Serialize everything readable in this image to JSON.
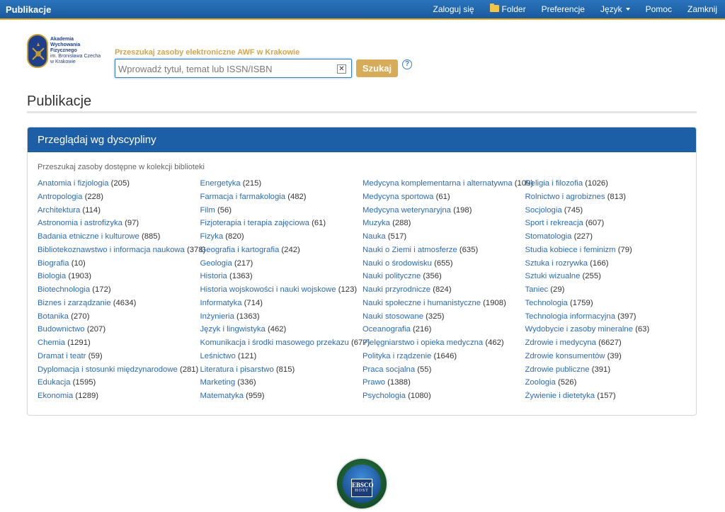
{
  "app": {
    "brand": "Publikacje"
  },
  "topnav": [
    {
      "label": "Zaloguj się",
      "name": "login-link"
    },
    {
      "label": "Folder",
      "name": "folder-link",
      "icon": "folder-icon"
    },
    {
      "label": "Preferencje",
      "name": "preferences-link"
    },
    {
      "label": "Język",
      "name": "language-menu",
      "dropdown": true
    },
    {
      "label": "Pomoc",
      "name": "help-link"
    },
    {
      "label": "Zamknij",
      "name": "close-link"
    }
  ],
  "logo": {
    "line1": "Akademia",
    "line2": "Wychowania",
    "line3": "Fizycznego",
    "line4": "im. Bronisława Czecha",
    "line5": "w Krakowie"
  },
  "search": {
    "label": "Przeszukaj zasoby elektroniczne AWF w Krakowie",
    "placeholder": "Wprowadź tytuł, temat lub ISSN/ISBN",
    "value": "",
    "button": "Szukaj",
    "clear": "✕",
    "help": "?"
  },
  "page": {
    "title": "Publikacje"
  },
  "panel": {
    "header": "Przeglądaj wg dyscypliny",
    "subtitle": "Przeszukaj zasoby dostępne w kolekcji biblioteki"
  },
  "disciplines": [
    [
      {
        "name": "Anatomia i fizjologia",
        "count": "(205)"
      },
      {
        "name": "Antropologia",
        "count": "(228)"
      },
      {
        "name": "Architektura",
        "count": "(114)"
      },
      {
        "name": "Astronomia i astrofizyka",
        "count": "(97)"
      },
      {
        "name": "Badania etniczne i kulturowe",
        "count": "(885)"
      },
      {
        "name": "Bibliotekoznawstwo i informacja naukowa",
        "count": "(378)"
      },
      {
        "name": "Biografia",
        "count": "(10)"
      },
      {
        "name": "Biologia",
        "count": "(1903)"
      },
      {
        "name": "Biotechnologia",
        "count": "(172)"
      },
      {
        "name": "Biznes i zarządzanie",
        "count": "(4634)"
      },
      {
        "name": "Botanika",
        "count": "(270)"
      },
      {
        "name": "Budownictwo",
        "count": "(207)"
      },
      {
        "name": "Chemia",
        "count": "(1291)"
      },
      {
        "name": "Dramat i teatr",
        "count": "(59)"
      },
      {
        "name": "Dyplomacja i stosunki międzynarodowe",
        "count": "(281)"
      },
      {
        "name": "Edukacja",
        "count": "(1595)"
      },
      {
        "name": "Ekonomia",
        "count": "(1289)"
      }
    ],
    [
      {
        "name": "Energetyka",
        "count": "(215)"
      },
      {
        "name": "Farmacja i farmakologia",
        "count": "(482)"
      },
      {
        "name": "Film",
        "count": "(56)"
      },
      {
        "name": "Fizjoterapia i terapia zajęciowa",
        "count": "(61)"
      },
      {
        "name": "Fizyka",
        "count": "(820)"
      },
      {
        "name": "Geografia i kartografia",
        "count": "(242)"
      },
      {
        "name": "Geologia",
        "count": "(217)"
      },
      {
        "name": "Historia",
        "count": "(1363)"
      },
      {
        "name": "Historia wojskowości i nauki wojskowe",
        "count": "(123)"
      },
      {
        "name": "Informatyka",
        "count": "(714)"
      },
      {
        "name": "Inżynieria",
        "count": "(1363)"
      },
      {
        "name": "Język i lingwistyka",
        "count": "(462)"
      },
      {
        "name": "Komunikacja i środki masowego przekazu",
        "count": "(677)"
      },
      {
        "name": "Leśnictwo",
        "count": "(121)"
      },
      {
        "name": "Literatura i pisarstwo",
        "count": "(815)"
      },
      {
        "name": "Marketing",
        "count": "(336)"
      },
      {
        "name": "Matematyka",
        "count": "(959)"
      }
    ],
    [
      {
        "name": "Medycyna komplementarna i alternatywna",
        "count": "(109)"
      },
      {
        "name": "Medycyna sportowa",
        "count": "(61)"
      },
      {
        "name": "Medycyna weterynaryjna",
        "count": "(198)"
      },
      {
        "name": "Muzyka",
        "count": "(288)"
      },
      {
        "name": "Nauka",
        "count": "(517)"
      },
      {
        "name": "Nauki o Ziemi i atmosferze",
        "count": "(635)"
      },
      {
        "name": "Nauki o środowisku",
        "count": "(655)"
      },
      {
        "name": "Nauki polityczne",
        "count": "(356)"
      },
      {
        "name": "Nauki przyrodnicze",
        "count": "(824)"
      },
      {
        "name": "Nauki społeczne i humanistyczne",
        "count": "(1908)"
      },
      {
        "name": "Nauki stosowane",
        "count": "(325)"
      },
      {
        "name": "Oceanografia",
        "count": "(216)"
      },
      {
        "name": "Pielęgniarstwo i opieka medyczna",
        "count": "(462)"
      },
      {
        "name": "Polityka i rządzenie",
        "count": "(1646)"
      },
      {
        "name": "Praca socjalna",
        "count": "(55)"
      },
      {
        "name": "Prawo",
        "count": "(1388)"
      },
      {
        "name": "Psychologia",
        "count": "(1080)"
      }
    ],
    [
      {
        "name": "Religia i filozofia",
        "count": "(1026)"
      },
      {
        "name": "Rolnictwo i agrobiznes",
        "count": "(813)"
      },
      {
        "name": "Socjologia",
        "count": "(745)"
      },
      {
        "name": "Sport i rekreacja",
        "count": "(607)"
      },
      {
        "name": "Stomatologia",
        "count": "(227)"
      },
      {
        "name": "Studia kobiece i feminizm",
        "count": "(79)"
      },
      {
        "name": "Sztuka i rozrywka",
        "count": "(166)"
      },
      {
        "name": "Sztuki wizualne",
        "count": "(255)"
      },
      {
        "name": "Taniec",
        "count": "(29)"
      },
      {
        "name": "Technologia",
        "count": "(1759)"
      },
      {
        "name": "Technologia informacyjna",
        "count": "(397)"
      },
      {
        "name": "Wydobycie i zasoby mineralne",
        "count": "(63)"
      },
      {
        "name": "Zdrowie i medycyna",
        "count": "(6627)"
      },
      {
        "name": "Zdrowie konsumentów",
        "count": "(39)"
      },
      {
        "name": "Zdrowie publiczne",
        "count": "(391)"
      },
      {
        "name": "Zoologia",
        "count": "(526)"
      },
      {
        "name": "Żywienie i dietetyka",
        "count": "(157)"
      }
    ]
  ],
  "footer": {
    "logo_line1": "EBSCO",
    "logo_line2": "HOST"
  },
  "colors": {
    "header_blue": "#1d5fa6",
    "accent_gold": "#d7ab58",
    "link_blue": "#2a6cb5"
  }
}
